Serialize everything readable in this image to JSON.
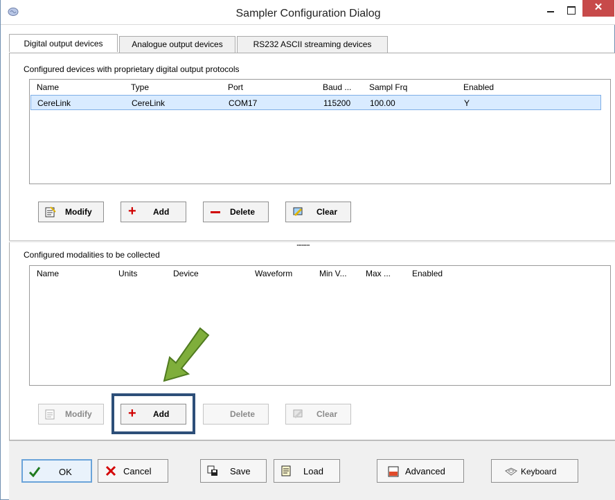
{
  "window": {
    "title": "Sampler Configuration Dialog",
    "close_glyph": "✕"
  },
  "tabs": [
    {
      "label": "Digital output devices"
    },
    {
      "label": "Analogue output devices"
    },
    {
      "label": "RS232 ASCII streaming devices"
    }
  ],
  "devices": {
    "section_label": "Configured devices with proprietary digital output protocols",
    "columns": [
      "Name",
      "Type",
      "Port",
      "Baud ...",
      "Sampl Frq",
      "Enabled"
    ],
    "rows": [
      [
        "CereLink",
        "CereLink",
        "COM17",
        "115200",
        "100.00",
        "Y"
      ]
    ],
    "buttons": {
      "modify": "Modify",
      "add": "Add",
      "delete": "Delete",
      "clear": "Clear"
    }
  },
  "modalities": {
    "section_label": "Configured modalities to be collected",
    "columns": [
      "Name",
      "Units",
      "Device",
      "Waveform",
      "Min V...",
      "Max ...",
      "Enabled"
    ],
    "rows": [],
    "buttons": {
      "modify": "Modify",
      "add": "Add",
      "delete": "Delete",
      "clear": "Clear"
    }
  },
  "splitter_grip": "........",
  "footer": {
    "ok": "OK",
    "cancel": "Cancel",
    "save": "Save",
    "load": "Load",
    "advanced": "Advanced",
    "keyboard": "Keyboard"
  },
  "icons": {
    "ok": "check-icon",
    "cancel": "x-icon",
    "save": "save-icon",
    "load": "load-icon",
    "advanced": "advanced-icon",
    "keyboard": "keyboard-icon"
  },
  "colors": {
    "selection": "#d9ebff",
    "callout_border": "#2d4f79",
    "arrow": "#7fae3b",
    "close_button": "#c74a4a",
    "accent_red": "#d00000"
  }
}
